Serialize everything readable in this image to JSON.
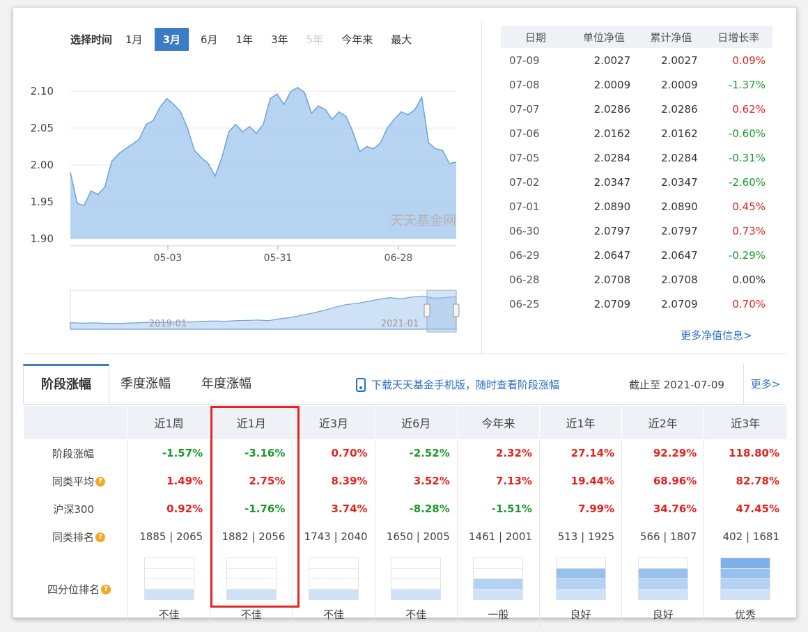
{
  "range_selector": {
    "label": "选择时间",
    "options": [
      {
        "label": "1月",
        "state": "normal"
      },
      {
        "label": "3月",
        "state": "active"
      },
      {
        "label": "6月",
        "state": "normal"
      },
      {
        "label": "1年",
        "state": "normal"
      },
      {
        "label": "3年",
        "state": "normal"
      },
      {
        "label": "5年",
        "state": "disabled"
      },
      {
        "label": "今年来",
        "state": "normal"
      },
      {
        "label": "最大",
        "state": "normal"
      }
    ]
  },
  "main_chart": {
    "y_ticks": [
      "2.10",
      "2.05",
      "2.00",
      "1.95",
      "1.90"
    ],
    "x_ticks": [
      "05-03",
      "05-31",
      "06-28"
    ],
    "watermark": "天天基金网",
    "fill_color": "#a9cbef",
    "line_color": "#6aa3dc",
    "values": [
      1.99,
      1.948,
      1.945,
      1.965,
      1.96,
      1.97,
      2.005,
      2.015,
      2.022,
      2.028,
      2.035,
      2.055,
      2.06,
      2.078,
      2.09,
      2.082,
      2.072,
      2.05,
      2.02,
      2.01,
      2.002,
      1.985,
      2.01,
      2.045,
      2.055,
      2.045,
      2.052,
      2.043,
      2.055,
      2.09,
      2.096,
      2.082,
      2.1,
      2.105,
      2.098,
      2.07,
      2.08,
      2.075,
      2.062,
      2.072,
      2.066,
      2.045,
      2.018,
      2.025,
      2.022,
      2.03,
      2.05,
      2.062,
      2.072,
      2.068,
      2.075,
      2.092,
      2.03,
      2.022,
      2.02,
      2.002,
      2.004
    ],
    "ylim": [
      1.9,
      2.1
    ]
  },
  "overview_chart": {
    "x_ticks": [
      "2019-01",
      "2021-01"
    ],
    "values": [
      0.12,
      0.1,
      0.11,
      0.1,
      0.09,
      0.1,
      0.11,
      0.13,
      0.12,
      0.14,
      0.15,
      0.14,
      0.16,
      0.17,
      0.16,
      0.18,
      0.19,
      0.2,
      0.18,
      0.24,
      0.28,
      0.35,
      0.42,
      0.5,
      0.6,
      0.68,
      0.72,
      0.78,
      0.85,
      0.9,
      0.86,
      0.92,
      0.95,
      0.88,
      0.9,
      0.93
    ]
  },
  "nav_table": {
    "headers": [
      "日期",
      "单位净值",
      "累计净值",
      "日增长率"
    ],
    "rows": [
      {
        "date": "07-09",
        "unit": "2.0027",
        "acc": "2.0027",
        "growth": "0.09%",
        "dir": "up"
      },
      {
        "date": "07-08",
        "unit": "2.0009",
        "acc": "2.0009",
        "growth": "-1.37%",
        "dir": "down"
      },
      {
        "date": "07-07",
        "unit": "2.0286",
        "acc": "2.0286",
        "growth": "0.62%",
        "dir": "up"
      },
      {
        "date": "07-06",
        "unit": "2.0162",
        "acc": "2.0162",
        "growth": "-0.60%",
        "dir": "down"
      },
      {
        "date": "07-05",
        "unit": "2.0284",
        "acc": "2.0284",
        "growth": "-0.31%",
        "dir": "down"
      },
      {
        "date": "07-02",
        "unit": "2.0347",
        "acc": "2.0347",
        "growth": "-2.60%",
        "dir": "down"
      },
      {
        "date": "07-01",
        "unit": "2.0890",
        "acc": "2.0890",
        "growth": "0.45%",
        "dir": "up"
      },
      {
        "date": "06-30",
        "unit": "2.0797",
        "acc": "2.0797",
        "growth": "0.73%",
        "dir": "up"
      },
      {
        "date": "06-29",
        "unit": "2.0647",
        "acc": "2.0647",
        "growth": "-0.29%",
        "dir": "down"
      },
      {
        "date": "06-28",
        "unit": "2.0708",
        "acc": "2.0708",
        "growth": "0.00%",
        "dir": "flat"
      },
      {
        "date": "06-25",
        "unit": "2.0709",
        "acc": "2.0709",
        "growth": "0.70%",
        "dir": "up"
      }
    ],
    "more_link": "更多净值信息>"
  },
  "tabs": {
    "items": [
      "阶段涨幅",
      "季度涨幅",
      "年度涨幅"
    ],
    "download_text": "下载天天基金手机版，随时查看阶段涨幅",
    "deadline": "截止至 2021-07-09",
    "more": "更多>"
  },
  "perf_table": {
    "columns": [
      "近1周",
      "近1月",
      "近3月",
      "近6月",
      "今年来",
      "近1年",
      "近2年",
      "近3年"
    ],
    "rows": [
      {
        "label": "阶段涨幅",
        "info": false,
        "values": [
          {
            "v": "-1.57%",
            "c": "green"
          },
          {
            "v": "-3.16%",
            "c": "green"
          },
          {
            "v": "0.70%",
            "c": "red"
          },
          {
            "v": "-2.52%",
            "c": "green"
          },
          {
            "v": "2.32%",
            "c": "red"
          },
          {
            "v": "27.14%",
            "c": "red"
          },
          {
            "v": "92.29%",
            "c": "red"
          },
          {
            "v": "118.80%",
            "c": "red"
          }
        ]
      },
      {
        "label": "同类平均",
        "info": true,
        "values": [
          {
            "v": "1.49%",
            "c": "red"
          },
          {
            "v": "2.75%",
            "c": "red"
          },
          {
            "v": "8.39%",
            "c": "red"
          },
          {
            "v": "3.52%",
            "c": "red"
          },
          {
            "v": "7.13%",
            "c": "red"
          },
          {
            "v": "19.44%",
            "c": "red"
          },
          {
            "v": "68.96%",
            "c": "red"
          },
          {
            "v": "82.78%",
            "c": "red"
          }
        ]
      },
      {
        "label": "沪深300",
        "info": false,
        "values": [
          {
            "v": "0.92%",
            "c": "red"
          },
          {
            "v": "-1.76%",
            "c": "green"
          },
          {
            "v": "3.74%",
            "c": "red"
          },
          {
            "v": "-8.28%",
            "c": "green"
          },
          {
            "v": "-1.51%",
            "c": "green"
          },
          {
            "v": "7.99%",
            "c": "red"
          },
          {
            "v": "34.76%",
            "c": "red"
          },
          {
            "v": "47.45%",
            "c": "red"
          }
        ]
      },
      {
        "label": "同类排名",
        "info": true,
        "values": [
          {
            "v": "1885 | 2065",
            "c": "rank"
          },
          {
            "v": "1882 | 2056",
            "c": "rank"
          },
          {
            "v": "1743 | 2040",
            "c": "rank"
          },
          {
            "v": "1650 | 2005",
            "c": "rank"
          },
          {
            "v": "1461 | 2001",
            "c": "rank"
          },
          {
            "v": "513 | 1925",
            "c": "rank"
          },
          {
            "v": "566 | 1807",
            "c": "rank"
          },
          {
            "v": "402 | 1681",
            "c": "rank"
          }
        ]
      }
    ],
    "quartile_label": "四分位排名",
    "quartiles": [
      {
        "level": 1,
        "label": "不佳"
      },
      {
        "level": 1,
        "label": "不佳"
      },
      {
        "level": 1,
        "label": "不佳"
      },
      {
        "level": 1,
        "label": "不佳"
      },
      {
        "level": 2,
        "label": "一般"
      },
      {
        "level": 3,
        "label": "良好"
      },
      {
        "level": 3,
        "label": "良好"
      },
      {
        "level": 4,
        "label": "优秀"
      }
    ],
    "highlight_color": "#e52521"
  }
}
